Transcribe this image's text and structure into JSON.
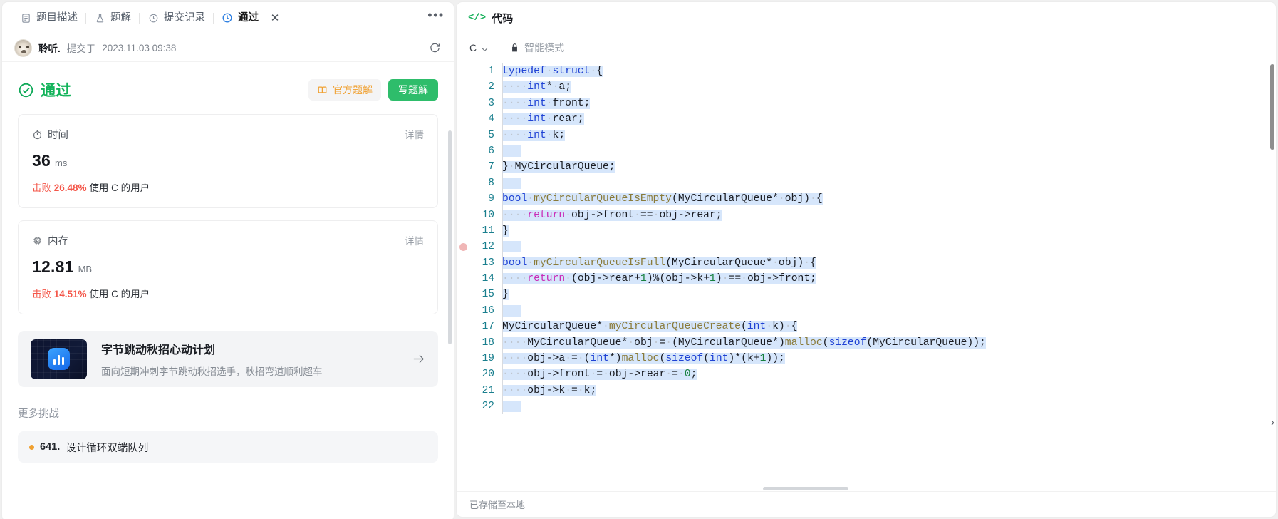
{
  "tabs": [
    {
      "id": "description",
      "label": "题目描述",
      "icon": "document-icon",
      "active": false
    },
    {
      "id": "solution",
      "label": "题解",
      "icon": "flask-icon",
      "active": false
    },
    {
      "id": "submissions",
      "label": "提交记录",
      "icon": "history-icon",
      "active": false
    },
    {
      "id": "accepted",
      "label": "通过",
      "icon": "history-icon",
      "active": true
    }
  ],
  "tabbar": {
    "more_label": "•••",
    "close_label": "✕"
  },
  "submission": {
    "user": "聆听.",
    "submitted_prefix": "提交于",
    "timestamp": "2023.11.03 09:38",
    "refresh_icon": "refresh-icon"
  },
  "result": {
    "status": "通过",
    "status_color": "#12b35a",
    "official_solution_button": "官方题解",
    "write_solution_button": "写题解"
  },
  "stats": [
    {
      "id": "time",
      "icon": "timer-icon",
      "title": "时间",
      "detail_label": "详情",
      "value": "36",
      "unit": "ms",
      "beat_prefix": "击败",
      "beat_percent": "26.48%",
      "beat_suffix": "使用 C 的用户",
      "beat_color": "#f4574a"
    },
    {
      "id": "memory",
      "icon": "chip-icon",
      "title": "内存",
      "detail_label": "详情",
      "value": "12.81",
      "unit": "MB",
      "beat_prefix": "击败",
      "beat_percent": "14.51%",
      "beat_suffix": "使用 C 的用户",
      "beat_color": "#f4574a"
    }
  ],
  "promo": {
    "title": "字节跳动秋招心动计划",
    "subtitle": "面向短期冲刺字节跳动秋招选手，秋招弯道顺利超车",
    "arrow_icon": "arrow-right-icon",
    "thumb_icon": "chart-badge-icon"
  },
  "more_challenges": {
    "heading": "更多挑战",
    "items": [
      {
        "number": "641.",
        "name": "设计循环双端队列"
      }
    ]
  },
  "code_panel": {
    "header_icon": "code-brackets-icon",
    "header_title": "代码",
    "language": "C",
    "language_chevron": "chevron-down-icon",
    "lock_icon": "lock-icon",
    "smart_mode_label": "智能模式",
    "footer_text": "已存储至本地",
    "line_numbers": [
      1,
      2,
      3,
      4,
      5,
      6,
      7,
      8,
      9,
      10,
      11,
      12,
      13,
      14,
      15,
      16,
      17,
      18,
      19,
      20,
      21,
      22
    ],
    "breakpoint_line": 12,
    "lines": [
      "typedef struct {",
      "    int* a;",
      "    int front;",
      "    int rear;",
      "    int k;",
      "",
      "} MyCircularQueue;",
      "",
      "bool myCircularQueueIsEmpty(MyCircularQueue* obj) {",
      "    return obj->front == obj->rear;",
      "}",
      "",
      "bool myCircularQueueIsFull(MyCircularQueue* obj) {",
      "    return (obj->rear+1)%(obj->k+1) == obj->front;",
      "}",
      "",
      "MyCircularQueue* myCircularQueueCreate(int k) {",
      "    MyCircularQueue* obj = (MyCircularQueue*)malloc(sizeof(MyCircularQueue));",
      "    obj->a = (int*)malloc(sizeof(int)*(k+1));",
      "    obj->front = obj->rear = 0;",
      "    obj->k = k;",
      ""
    ]
  }
}
